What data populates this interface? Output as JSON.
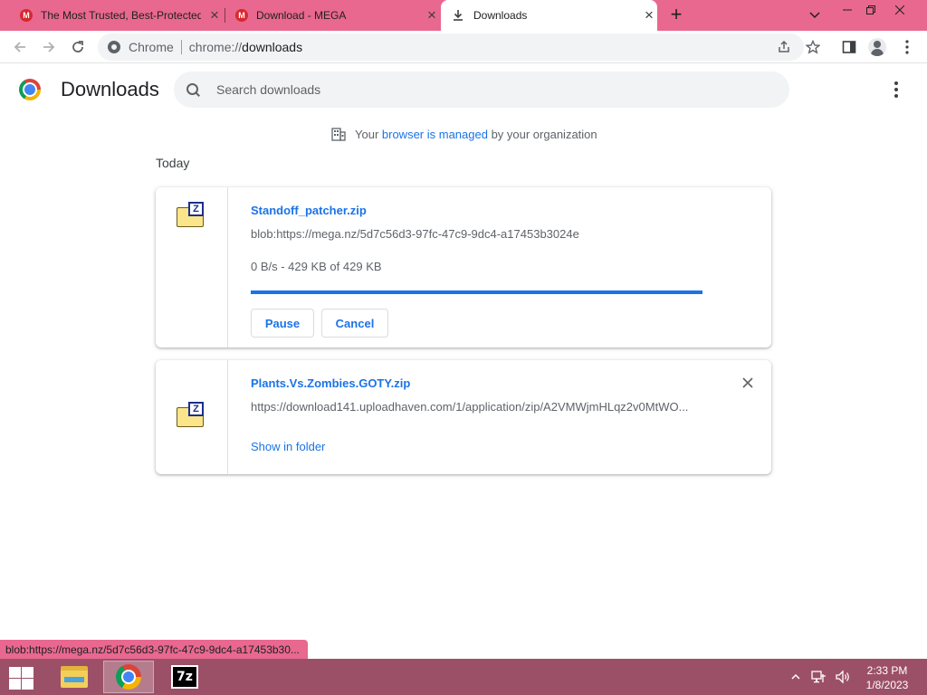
{
  "browser": {
    "tabs": [
      {
        "title": "The Most Trusted, Best-Protected",
        "favicon": "M",
        "active": false
      },
      {
        "title": "Download - MEGA",
        "favicon": "M",
        "active": false
      },
      {
        "title": "Downloads",
        "favicon": "download-icon",
        "active": true
      }
    ],
    "new_tab_label": "+",
    "omnibox": {
      "scheme_label": "Chrome",
      "url_prefix": "chrome://",
      "url_host": "downloads"
    }
  },
  "page": {
    "title": "Downloads",
    "search_placeholder": "Search downloads",
    "managed": {
      "prefix": "Your ",
      "link": "browser is managed",
      "suffix": " by your organization"
    },
    "section_label": "Today"
  },
  "downloads": [
    {
      "filename": "Standoff_patcher.zip",
      "url": "blob:https://mega.nz/5d7c56d3-97fc-47c9-9dc4-a17453b3024e",
      "status": "0 B/s - 429 KB of 429 KB",
      "progress": 1.0,
      "buttons": {
        "pause": "Pause",
        "cancel": "Cancel"
      }
    },
    {
      "filename": "Plants.Vs.Zombies.GOTY.zip",
      "url": "https://download141.uploadhaven.com/1/application/zip/A2VMWjmHLqz2v0MtWO...",
      "link": "Show in folder"
    }
  ],
  "status_bubble": "blob:https://mega.nz/5d7c56d3-97fc-47c9-9dc4-a17453b30...",
  "taskbar": {
    "apps": [
      "file-explorer",
      "chrome",
      "7-zip"
    ],
    "sevenzip_label": "7z",
    "clock": {
      "time": "2:33 PM",
      "date": "1/8/2023"
    }
  },
  "colors": {
    "accent": "#1a73e8",
    "tabstrip": "#e8688f",
    "taskbar": "#9c5068"
  }
}
